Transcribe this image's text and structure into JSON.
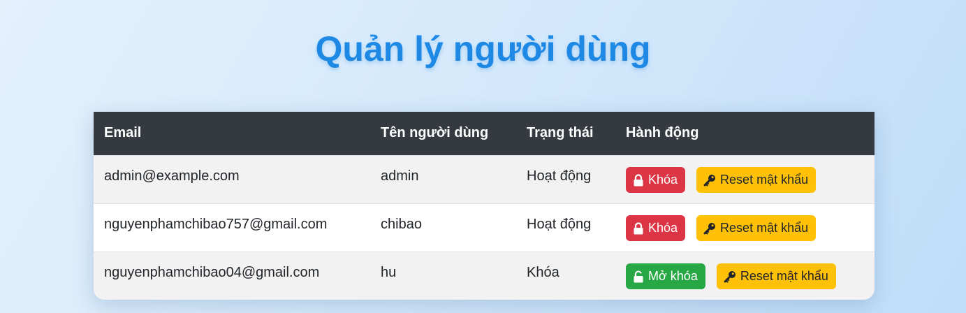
{
  "page": {
    "title": "Quản lý người dùng"
  },
  "table": {
    "headers": {
      "email": "Email",
      "username": "Tên người dùng",
      "status": "Trạng thái",
      "actions": "Hành động"
    },
    "rows": [
      {
        "email": "admin@example.com",
        "username": "admin",
        "status": "Hoạt động",
        "lock_button": {
          "label": "Khóa",
          "icon": "lock-icon",
          "color": "#dc3545"
        },
        "reset_button": {
          "label": "Reset mật khẩu",
          "icon": "key-icon",
          "color": "#ffc107"
        }
      },
      {
        "email": "nguyenphamchibao757@gmail.com",
        "username": "chibao",
        "status": "Hoạt động",
        "lock_button": {
          "label": "Khóa",
          "icon": "lock-icon",
          "color": "#dc3545"
        },
        "reset_button": {
          "label": "Reset mật khẩu",
          "icon": "key-icon",
          "color": "#ffc107"
        }
      },
      {
        "email": "nguyenphamchibao04@gmail.com",
        "username": "hu",
        "status": "Khóa",
        "lock_button": {
          "label": "Mở khóa",
          "icon": "unlock-icon",
          "color": "#28a745"
        },
        "reset_button": {
          "label": "Reset mật khẩu",
          "icon": "key-icon",
          "color": "#ffc107"
        }
      }
    ]
  },
  "colors": {
    "title": "#1e88e5",
    "header_bg": "#343a40",
    "danger": "#dc3545",
    "success": "#28a745",
    "warning": "#ffc107"
  }
}
